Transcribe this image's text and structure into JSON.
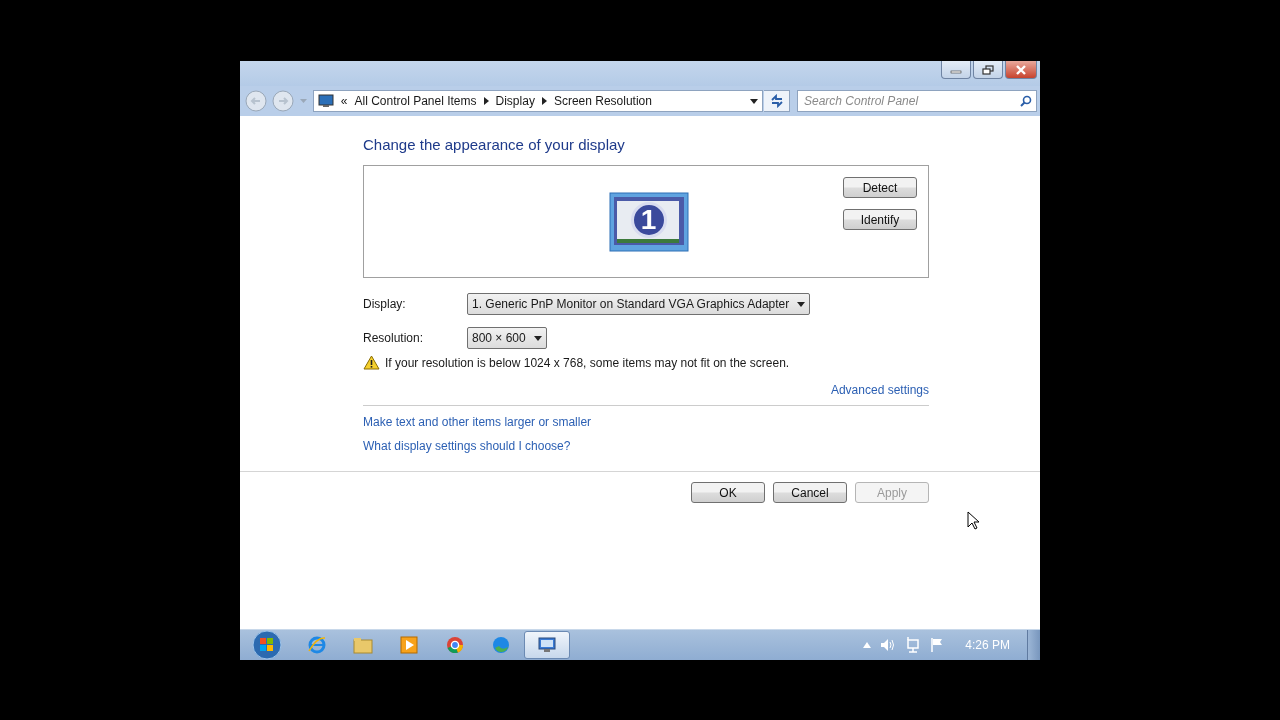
{
  "address_bar": {
    "overflow": "«",
    "crumbs": [
      "All Control Panel Items",
      "Display",
      "Screen Resolution"
    ]
  },
  "search": {
    "placeholder": "Search Control Panel"
  },
  "heading": "Change the appearance of your display",
  "monitor": {
    "number": "1"
  },
  "side_buttons": [
    "Detect",
    "Identify"
  ],
  "fields": [
    {
      "label": "Display:",
      "value": "1. Generic PnP Monitor on Standard VGA Graphics Adapter"
    },
    {
      "label": "Resolution:",
      "value": "800 × 600"
    }
  ],
  "warning": "If your resolution is below 1024 x 768, some items may not fit on the screen.",
  "advanced_link": "Advanced settings",
  "links": [
    "Make text and other items larger or smaller",
    "What display settings should I choose?"
  ],
  "buttons": [
    {
      "label": "OK",
      "disabled": false
    },
    {
      "label": "Cancel",
      "disabled": false
    },
    {
      "label": "Apply",
      "disabled": true
    }
  ],
  "taskbar": {
    "items": [
      {
        "kind": "ie",
        "selected": false
      },
      {
        "kind": "folder",
        "selected": false
      },
      {
        "kind": "media",
        "selected": false
      },
      {
        "kind": "chrome",
        "selected": false
      },
      {
        "kind": "edge",
        "selected": false
      },
      {
        "kind": "display",
        "selected": true
      }
    ],
    "clock": "4:26 PM"
  }
}
